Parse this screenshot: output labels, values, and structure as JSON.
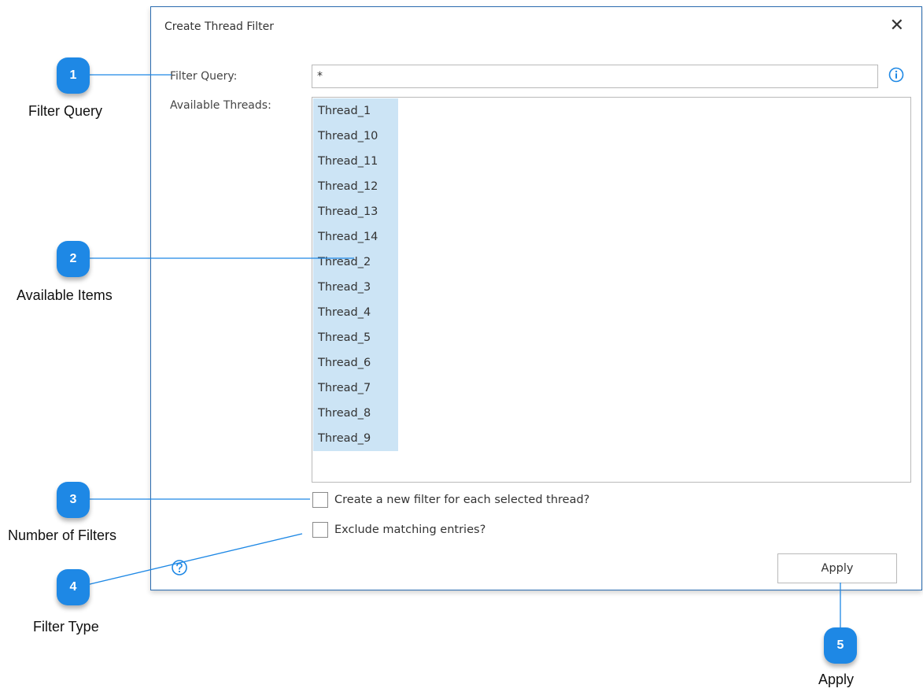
{
  "dialog": {
    "title": "Create Thread Filter",
    "close_glyph": "✕",
    "filter_query_label": "Filter Query:",
    "filter_query_value": "*",
    "available_threads_label": "Available Threads:",
    "threads": [
      "Thread_1",
      "Thread_10",
      "Thread_11",
      "Thread_12",
      "Thread_13",
      "Thread_14",
      "Thread_2",
      "Thread_3",
      "Thread_4",
      "Thread_5",
      "Thread_6",
      "Thread_7",
      "Thread_8",
      "Thread_9"
    ],
    "checkbox_new_filter_label": "Create a new filter for each selected thread?",
    "checkbox_exclude_label": "Exclude matching entries?",
    "apply_label": "Apply"
  },
  "callouts": [
    {
      "number": "1",
      "caption": "Filter Query"
    },
    {
      "number": "2",
      "caption": "Available Items"
    },
    {
      "number": "3",
      "caption": "Number of Filters"
    },
    {
      "number": "4",
      "caption": "Filter Type"
    },
    {
      "number": "5",
      "caption": "Apply"
    }
  ],
  "colors": {
    "accent": "#1e88e5",
    "selection": "#cce4f5",
    "dialog_border": "#2b6cb0"
  }
}
